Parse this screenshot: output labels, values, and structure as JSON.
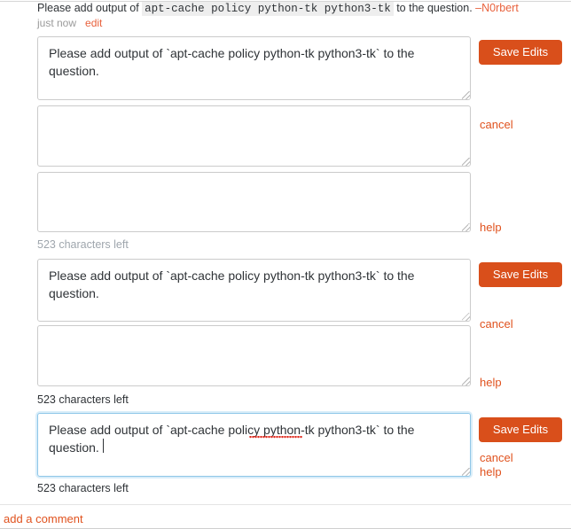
{
  "comment": {
    "text_before": "Please add output of",
    "code": "apt-cache policy python-tk python3-tk",
    "text_after": "to the question.",
    "dash": "–",
    "author": "N0rbert",
    "timestamp": "just now",
    "edit_label": "edit"
  },
  "editors": [
    {
      "value": "Please add output of `apt-cache policy python-tk python3-tk` to the question.",
      "save_label": "Save Edits",
      "cancel_label": "cancel",
      "help_label": "help",
      "extra_fields": [
        "",
        ""
      ],
      "chars_left": "523 characters left"
    },
    {
      "value": "Please add output of `apt-cache policy python-tk python3-tk` to the question.",
      "save_label": "Save Edits",
      "cancel_label": "cancel",
      "help_label": "help",
      "extra_fields": [
        ""
      ],
      "chars_left": "523 characters left"
    },
    {
      "value": "Please add output of `apt-cache policy python-tk python3-tk` to the question.",
      "save_label": "Save Edits",
      "cancel_label": "cancel",
      "help_label": "help",
      "extra_fields": [],
      "chars_left": "523 characters left"
    }
  ],
  "footer": {
    "add_comment_label": "add a comment"
  },
  "colors": {
    "accent": "#d94f1b",
    "link": "#e0521e",
    "muted": "#9fa6ad",
    "text": "#2f3337",
    "border": "#cbcbcb",
    "focus_border": "#8fc7e8",
    "focus_glow": "#d9edf9",
    "spellcheck": "#e02b1f"
  }
}
